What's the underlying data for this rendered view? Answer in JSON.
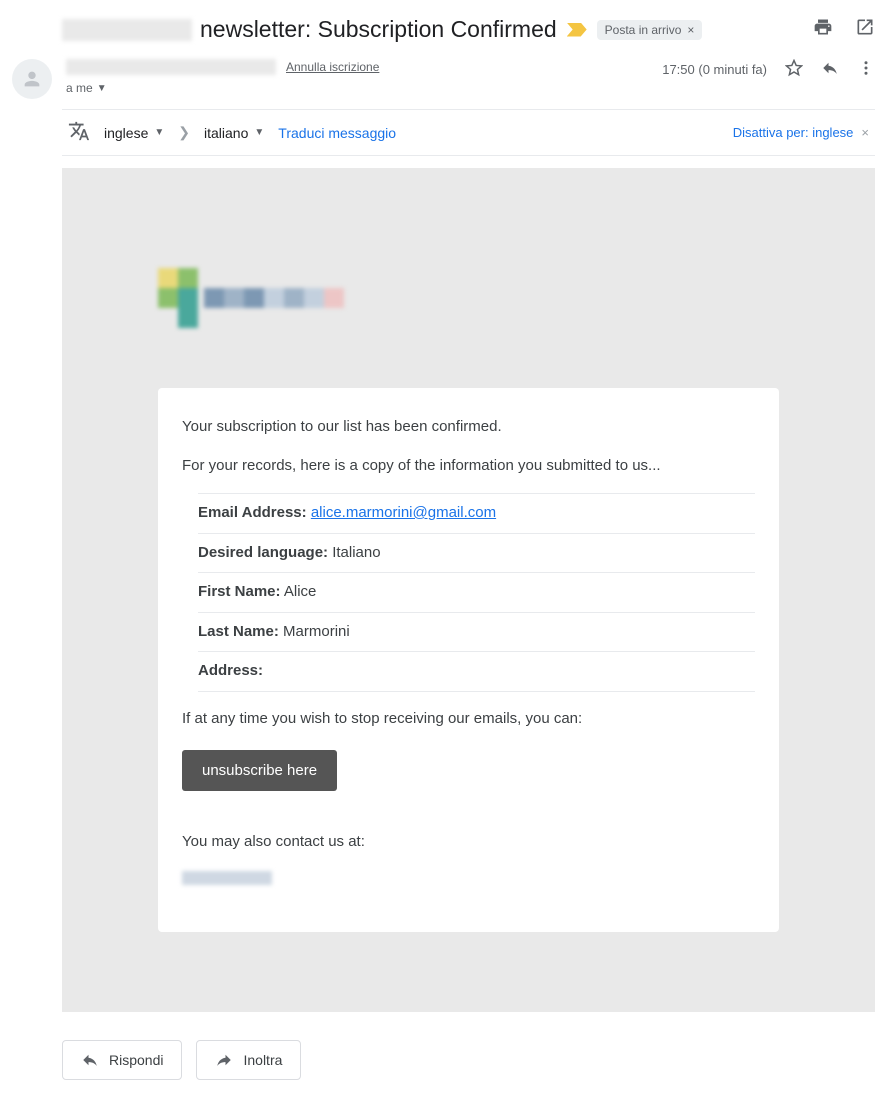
{
  "subject": {
    "text": "newsletter: Subscription Confirmed",
    "label": "Posta in arrivo"
  },
  "sender": {
    "unsubscribe": "Annulla iscrizione",
    "to_line": "a me",
    "time": "17:50 (0 minuti fa)"
  },
  "translate": {
    "from": "inglese",
    "to": "italiano",
    "action": "Traduci messaggio",
    "disable": "Disattiva per: inglese"
  },
  "body": {
    "confirm": "Your subscription to our list has been confirmed.",
    "records": "For your records, here is a copy of the information you submitted to us...",
    "fields": {
      "email_label": "Email Address:",
      "email_value": "alice.marmorini@gmail.com",
      "lang_label": "Desired language:",
      "lang_value": "Italiano",
      "first_label": "First Name:",
      "first_value": "Alice",
      "last_label": "Last Name:",
      "last_value": "Marmorini",
      "addr_label": "Address:",
      "addr_value": ""
    },
    "stop": "If at any time you wish to stop receiving our emails, you can:",
    "unsub_btn": "unsubscribe here",
    "contact": "You may also contact us at:"
  },
  "footer": {
    "reply": "Rispondi",
    "forward": "Inoltra"
  }
}
